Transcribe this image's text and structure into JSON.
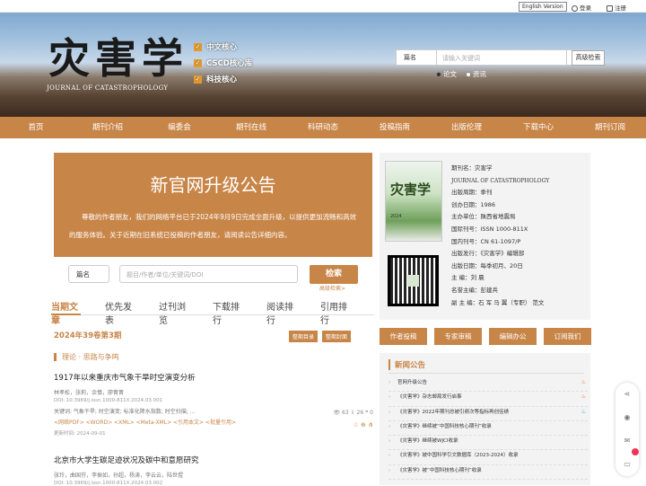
{
  "topbar": {
    "english": "English Version",
    "login": "登录",
    "register": "注册"
  },
  "banner": {
    "logo_cn": "灾害学",
    "logo_en": "JOURNAL OF CATASTROPHOLOGY",
    "badges": [
      "中文核心",
      "CSCD核心库",
      "科技核心"
    ]
  },
  "search": {
    "type": "篇名",
    "placeholder": "请输入关键词",
    "advanced": "高级检索",
    "radio1": "论文",
    "radio2": "资讯"
  },
  "nav": [
    "首页",
    "期刊介绍",
    "编委会",
    "期刊在线",
    "科研动态",
    "投稿指南",
    "出版伦理",
    "下载中心",
    "期刊订阅"
  ],
  "notice": {
    "title": "新官网升级公告",
    "body": "尊敬的作者朋友，我们的网络平台已于2024年9月9日完成全面升级，以提供更加流畅和高效的服务体验。关于近期在旧系统已投稿的作者朋友，请阅读公告详细内容。"
  },
  "search2": {
    "type": "篇名",
    "placeholder": "题目/作者/单位/关键词/DOI",
    "button": "检索",
    "advanced": "高级检索>"
  },
  "tabs": [
    "当期文章",
    "优先发表",
    "过刊浏览",
    "下载排行",
    "阅读排行",
    "引用排行"
  ],
  "issue": {
    "label": "2024年39卷第3期",
    "btn_toc": "整期目录",
    "btn_cover": "整期封面"
  },
  "section": "理论 · 思路与争鸣",
  "articles": [
    {
      "title": "1917年以来重庆市气象干旱时空演变分析",
      "authors": "林孝松，张莉，余慎，廖菁菁",
      "doi": "DOI:  10.3969/j.issn.1000-811X.2024.03.001",
      "keywords": "关键词:  气象干旱; 时空演变; 标准化降水指数; 时空扫描; ...",
      "links": "<网络PDF>  <WORD>  <XML>  <Meta-XML>  <引用本文>  <批量引用>",
      "update": "更新时间:    2024-09-01",
      "stats": "👁 63  ⇩ 26  ❝ 0"
    },
    {
      "title": "北京市大学生碳足迹状况及碳中和意愿研究",
      "authors": "张玲，曲国芬，李振如，孙超，杨涛，李云云，陆世煜",
      "doi": "DOI:  10.3969/j.issn.1000-811X.2024.03.002"
    }
  ],
  "journal": {
    "cover_title": "灾害学",
    "cover_year": "2024",
    "fields": [
      "期刊名：灾害学",
      "JOURNAL OF CATASTROPHOLOGY",
      "出版周期：季刊",
      "创办日期：1986",
      "主办单位：陕西省地震局",
      "国际刊号：ISSN 1000-811X",
      "国内刊号：CN 61-1097/P",
      "出版发行：《灾害学》编辑部",
      "出版日期：每季初月、20日",
      "主    编：刘  晨",
      "名誉主编：彭建兵",
      "副 主 编：石  军  马  翼（专职）  范文"
    ]
  },
  "actions": [
    "作者投稿",
    "专家审稿",
    "编辑办公",
    "订阅我们"
  ],
  "news": {
    "title": "新闻公告",
    "items": [
      "官网升级公告",
      "《灾害学》杂志邮局发行启事",
      "《灾害学》2022年期刊总被引频次等指标再创佳绩",
      "《灾害学》继续被“中国科技核心期刊”收录",
      "《灾害学》继续被WJCI收录",
      "《灾害学》被中国科学引文数据库（2023-2024）收录",
      "《灾害学》被“中国科技核心期刊”收录"
    ]
  }
}
